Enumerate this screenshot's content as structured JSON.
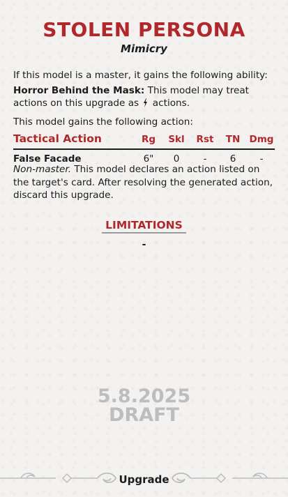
{
  "card": {
    "title": "STOLEN PERSONA",
    "subtitle": "Mimicry"
  },
  "intro": {
    "line1": "If this model is a master, it gains the following ability:",
    "ability_name": "Horror Behind the Mask:",
    "ability_text_before_icon": " This model may treat actions on this upgrade as",
    "ability_text_after_icon": " actions.",
    "ability_icon": "signature-bolt-icon",
    "line3": "This model gains the following action:"
  },
  "action_table": {
    "header_title": "Tactical Action",
    "columns": [
      "Rg",
      "Skl",
      "Rst",
      "TN",
      "Dmg"
    ],
    "row": {
      "name": "False Facade",
      "values": [
        "6\"",
        "0",
        "-",
        "6",
        "-"
      ]
    },
    "desc_italic": "Non-master.",
    "desc_text": " This model declares an action listed on the target's card. After resolving the generated action, discard this upgrade."
  },
  "limitations": {
    "heading": "LIMITATIONS",
    "value": "-"
  },
  "watermark": {
    "line1": "5.8.2025",
    "line2": "DRAFT"
  },
  "footer": {
    "label": "Upgrade"
  },
  "colors": {
    "accent": "#b0282c",
    "text": "#1c1c1c",
    "watermark": "#bdbdbd",
    "background": "#f3f2f0"
  }
}
